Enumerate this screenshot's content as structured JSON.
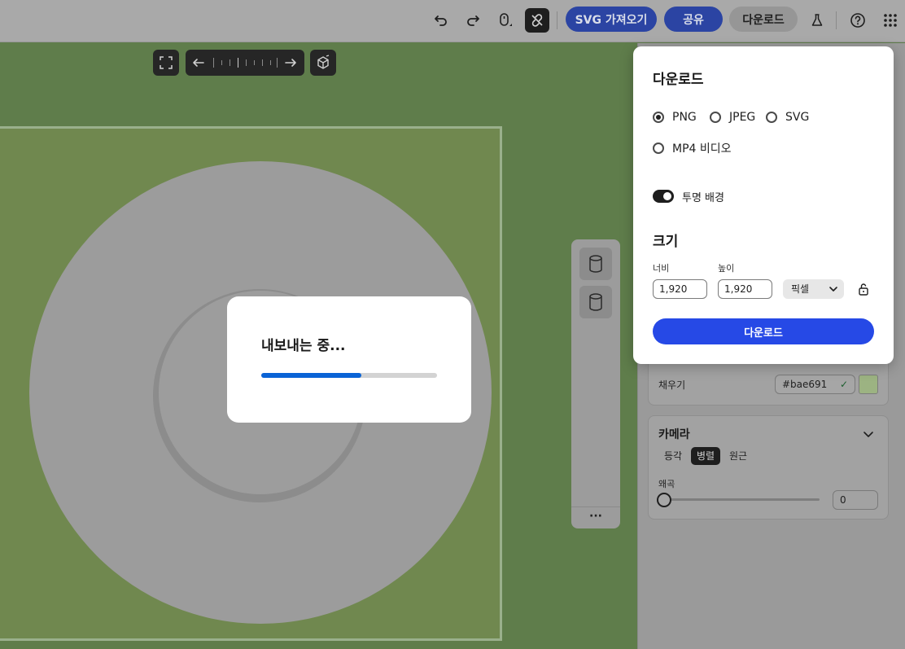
{
  "toolbar": {
    "import_svg_label": "SVG 가져오기",
    "share_label": "공유",
    "download_label": "다운로드",
    "icons": [
      "undo-icon",
      "redo-icon",
      "mouse-icon",
      "unlink-icon",
      "flask-icon",
      "help-icon",
      "apps-grid-icon"
    ]
  },
  "canvas": {
    "background_color": "#5f7d4b",
    "frame_color": "#70884f",
    "shape_color": "#9c9c9c"
  },
  "side_tools": {
    "more_label": "···"
  },
  "properties": {
    "fill_label": "채우기",
    "fill_hex": "#bae691",
    "fill_color": "#bae691"
  },
  "camera": {
    "title": "카메라",
    "modes": [
      "등각",
      "병렬",
      "원근"
    ],
    "active_mode": "병렬",
    "distortion_label": "왜곡",
    "distortion_value": "0"
  },
  "download_popover": {
    "title": "다운로드",
    "formats": [
      {
        "label": "PNG",
        "checked": true
      },
      {
        "label": "JPEG",
        "checked": false
      },
      {
        "label": "SVG",
        "checked": false
      },
      {
        "label": "MP4 비디오",
        "checked": false
      }
    ],
    "transparent_label": "투명 배경",
    "transparent_on": true,
    "size_title": "크기",
    "width_label": "너비",
    "width_value": "1,920",
    "height_label": "높이",
    "height_value": "1,920",
    "unit": "픽셀",
    "button_label": "다운로드"
  },
  "export_modal": {
    "title": "내보내는 중...",
    "progress_percent": 57
  }
}
